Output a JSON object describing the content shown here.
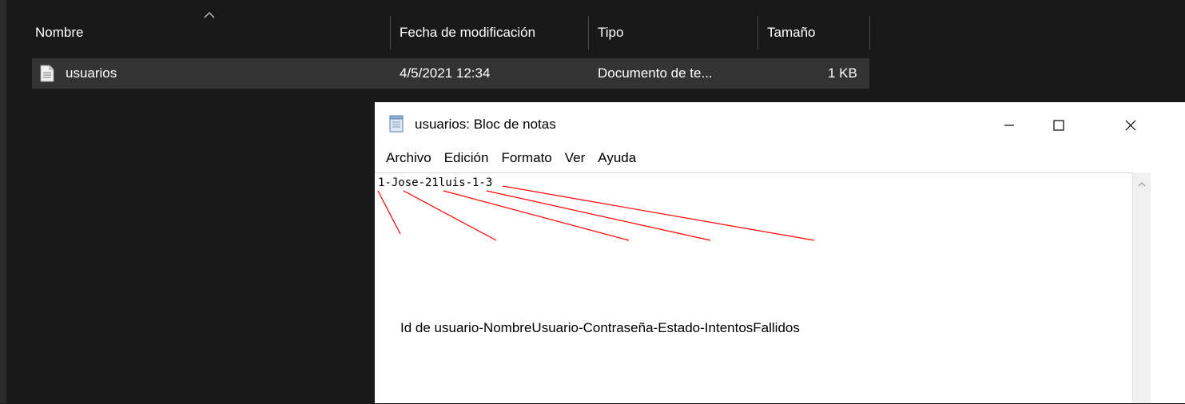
{
  "explorer": {
    "columns": [
      "Nombre",
      "Fecha de modificación",
      "Tipo",
      "Tamaño"
    ],
    "files": [
      {
        "name": "usuarios",
        "modified": "4/5/2021 12:34",
        "type": "Documento de te...",
        "size": "1 KB"
      }
    ]
  },
  "notepad": {
    "title": "usuarios: Bloc de notas",
    "menu": [
      "Archivo",
      "Edición",
      "Formato",
      "Ver",
      "Ayuda"
    ],
    "content": "1-Jose-21luis-1-3",
    "annotation": "Id de usuario-NombreUsuario-Contraseña-Estado-IntentosFallidos",
    "controls": {
      "minimize": "minimize-icon",
      "maximize": "maximize-icon",
      "close": "close-icon"
    }
  },
  "colors": {
    "explorer_bg": "#191919",
    "row_selected": "#333333",
    "annotation_lines": "#ff0000"
  }
}
